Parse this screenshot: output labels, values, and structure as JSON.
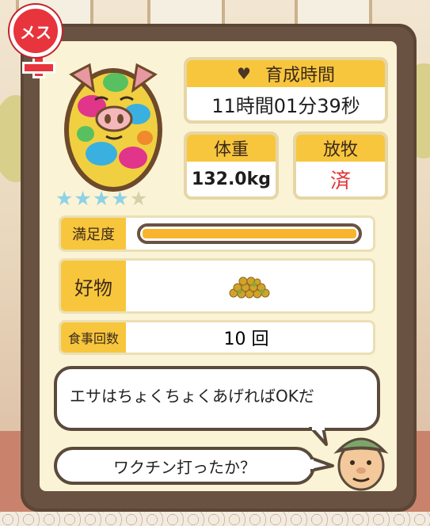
{
  "badge": {
    "label": "メス"
  },
  "pig": {
    "stars_filled": 4,
    "stars_total": 5
  },
  "stats": {
    "time_label": "育成時間",
    "time_value": "11時間01分39秒",
    "weight_label": "体重",
    "weight_value": "132.0kg",
    "graze_label": "放牧",
    "graze_value": "済"
  },
  "rows": {
    "satisfaction_label": "満足度",
    "satisfaction_level": 1.0,
    "favorite_label": "好物",
    "favorite_icon": "grain-pile-icon",
    "meals_label": "食事回数",
    "meals_value": "10 回"
  },
  "dialogue": {
    "speech_1": "エサはちょくちょくあげればOKだ",
    "speech_2": "ワクチン打ったか？"
  },
  "colors": {
    "accent_yellow": "#f7c63c",
    "frame_brown": "#6a5243",
    "female_red": "#e8343c",
    "graze_done_red": "#e33535",
    "star_blue": "#8ed2e6"
  }
}
